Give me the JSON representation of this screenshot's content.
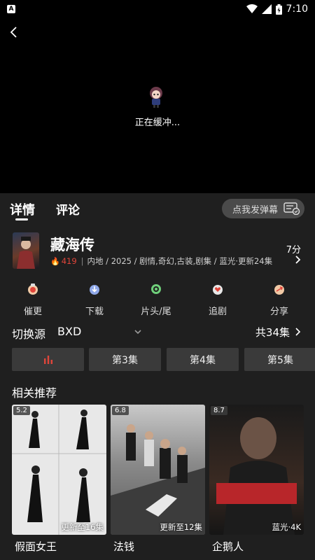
{
  "status_bar": {
    "app_icon_letter": "A",
    "time": "7:10"
  },
  "player": {
    "buffering_text": "正在缓冲..."
  },
  "tabs": {
    "detail": "详情",
    "comment": "评论",
    "danmu_button": "点我发弹幕"
  },
  "show": {
    "title": "藏海传",
    "heat": "419",
    "meta": "内地 / 2025 / 剧情,奇幻,古装,剧集 / 蓝光·更新24集",
    "score": "7分"
  },
  "actions": [
    {
      "label": "催更"
    },
    {
      "label": "下载"
    },
    {
      "label": "片头/尾"
    },
    {
      "label": "追剧"
    },
    {
      "label": "分享"
    }
  ],
  "source": {
    "label": "切换源",
    "value": "BXD",
    "episode_count": "共34集"
  },
  "episodes": [
    {
      "label": "",
      "playing": true
    },
    {
      "label": "第3集"
    },
    {
      "label": "第4集"
    },
    {
      "label": "第5集"
    }
  ],
  "recommendations": {
    "title": "相关推荐",
    "items": [
      {
        "score": "5.2",
        "update": "更新至16集",
        "name": "假面女王"
      },
      {
        "score": "6.8",
        "update": "更新至12集",
        "name": "法钱"
      },
      {
        "score": "8.7",
        "update": "蓝光·4K",
        "name": "企鹅人"
      }
    ]
  },
  "colors": {
    "accent_red": "#e0453a",
    "sheet_bg": "#1f1f1f",
    "button_bg": "#3a3a3a"
  }
}
